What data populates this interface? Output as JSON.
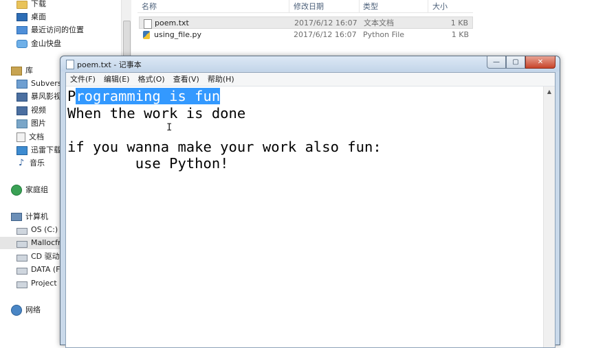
{
  "explorer": {
    "nav": {
      "favorites": [
        {
          "label": "下载",
          "icon": "downloads-folder-icon"
        },
        {
          "label": "桌面",
          "icon": "desktop-icon"
        },
        {
          "label": "最近访问的位置",
          "icon": "recent-places-icon"
        },
        {
          "label": "金山快盘",
          "icon": "kuaipan-cloud-icon"
        }
      ],
      "library_label": "库",
      "library": [
        {
          "label": "Subversion",
          "icon": "subversion-icon"
        },
        {
          "label": "暴风影视库",
          "icon": "video-library-icon"
        },
        {
          "label": "视频",
          "icon": "video-icon"
        },
        {
          "label": "图片",
          "icon": "pictures-icon"
        },
        {
          "label": "文档",
          "icon": "documents-icon"
        },
        {
          "label": "迅雷下载",
          "icon": "thunder-download-icon"
        },
        {
          "label": "音乐",
          "icon": "music-icon"
        }
      ],
      "homegroup_label": "家庭组",
      "computer_label": "计算机",
      "drives": [
        {
          "label": "OS (C:)",
          "icon": "drive-icon"
        },
        {
          "label": "Mallocfre",
          "icon": "drive-icon"
        },
        {
          "label": "CD 驱动器",
          "icon": "cd-drive-icon"
        },
        {
          "label": "DATA (F:)",
          "icon": "drive-icon"
        },
        {
          "label": "Project (H",
          "icon": "drive-icon"
        }
      ],
      "network_label": "网络"
    },
    "columns": {
      "name": "名称",
      "date": "修改日期",
      "type": "类型",
      "size": "大小"
    },
    "files": [
      {
        "name": "poem.txt",
        "date": "2017/6/12 16:07",
        "type": "文本文档",
        "size": "1 KB",
        "icon": "text-file-icon"
      },
      {
        "name": "using_file.py",
        "date": "2017/6/12 16:07",
        "type": "Python File",
        "size": "1 KB",
        "icon": "python-file-icon"
      }
    ]
  },
  "notepad": {
    "title": "poem.txt - 记事本",
    "buttons": {
      "minimize": "—",
      "maximize": "▢",
      "close": "✕"
    },
    "menu": [
      "文件(F)",
      "编辑(E)",
      "格式(O)",
      "查看(V)",
      "帮助(H)"
    ],
    "content": {
      "line1_before": "P",
      "line1_selected": "rogramming is fun",
      "rest": "\nWhen the work is done\n\nif you wanna make your work also fun:\n        use Python!"
    },
    "cursor": "I"
  }
}
